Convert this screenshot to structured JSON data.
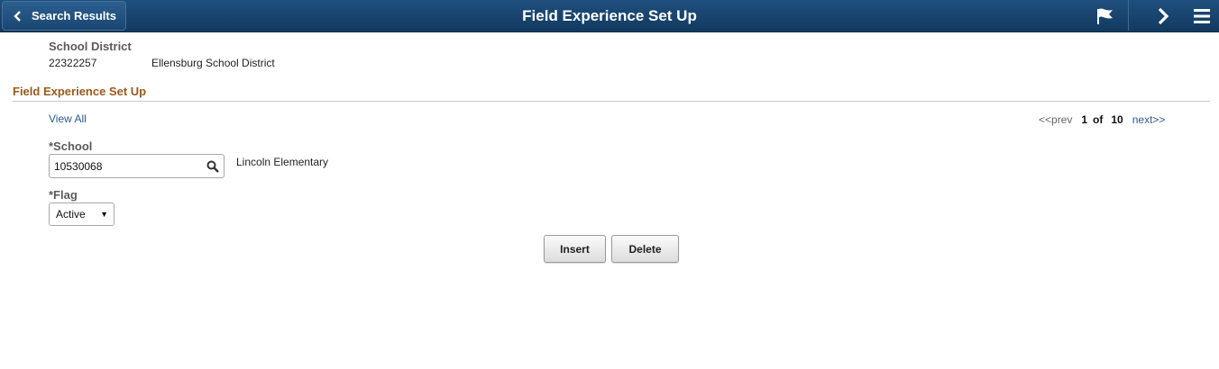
{
  "header": {
    "back_label": "Search Results",
    "title": "Field Experience Set Up",
    "icons": [
      "chevron-left-icon",
      "flag-icon",
      "chevron-right-icon",
      "menu-icon"
    ]
  },
  "district": {
    "label": "School District",
    "id": "22322257",
    "name": "Ellensburg School District"
  },
  "section": {
    "title": "Field Experience Set Up",
    "view_all": "View All",
    "pager": {
      "prev": "<<prev",
      "current": "1",
      "of": "of",
      "total": "10",
      "next": "next>>"
    }
  },
  "form": {
    "school_label": "*School",
    "school_value": "10530068",
    "school_name": "Lincoln Elementary",
    "flag_label": "*Flag",
    "flag_value": "Active"
  },
  "buttons": {
    "insert": "Insert",
    "delete": "Delete"
  },
  "colors": {
    "header_bg": "#1a4672",
    "section_title": "#9a5a1b",
    "link": "#2a5c8a"
  }
}
